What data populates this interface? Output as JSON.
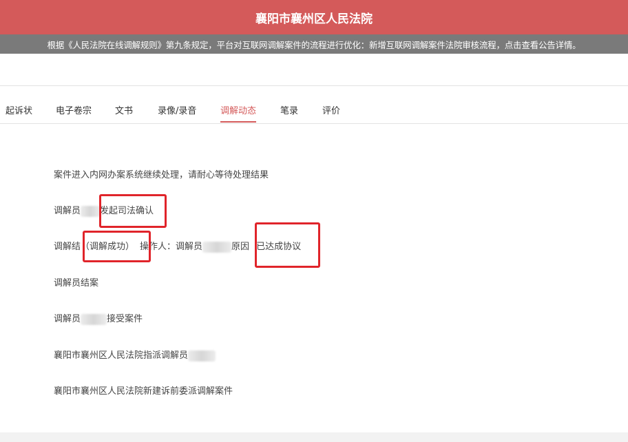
{
  "header": {
    "title": "襄阳市襄州区人民法院"
  },
  "notice": {
    "text": "根据《人民法院在线调解规则》第九条规定，平台对互联网调解案件的流程进行优化：新增互联网调解案件法院审核流程，点击查看公告详情。"
  },
  "tabs": [
    {
      "label": "起诉状"
    },
    {
      "label": "电子卷宗"
    },
    {
      "label": "文书"
    },
    {
      "label": "录像/录音"
    },
    {
      "label": "调解动态",
      "active": true
    },
    {
      "label": "笔录"
    },
    {
      "label": "评价"
    }
  ],
  "timeline": {
    "e1": "案件进入内网办案系统继续处理，请耐心等待处理结果",
    "e2_prefix": "调解员",
    "e2_suffix": "发起司法确认",
    "e3_a": "调解结",
    "e3_b": "（调解成功）",
    "e3_c": "操作人：调解员",
    "e3_d": "原因",
    "e3_e": "已达成协议",
    "e4": "调解员结案",
    "e5_prefix": "调解员",
    "e5_suffix": "接受案件",
    "e6_prefix": "襄阳市襄州区人民法院指派调解员",
    "e7": "襄阳市襄州区人民法院新建诉前委派调解案件"
  },
  "colors": {
    "brand_red": "#d45a5a",
    "notice_gray": "#7a7a7a",
    "highlight_red": "#e0242a"
  }
}
